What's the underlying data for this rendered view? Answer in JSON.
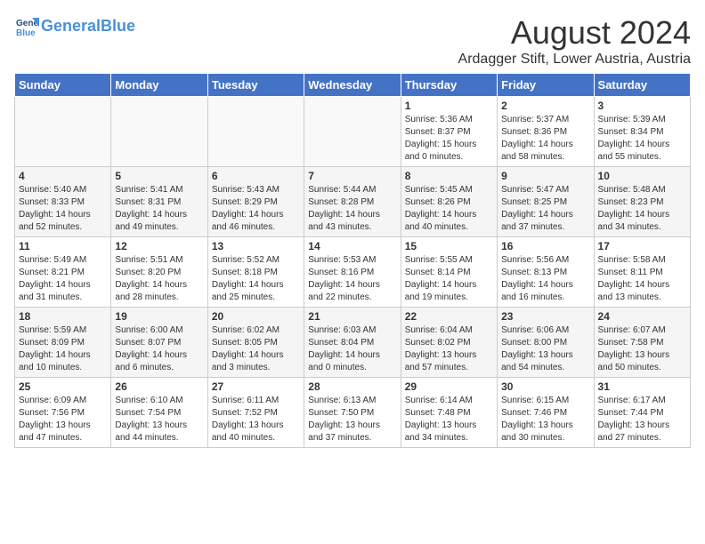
{
  "header": {
    "logo_line1": "General",
    "logo_line2": "Blue",
    "title": "August 2024",
    "subtitle": "Ardagger Stift, Lower Austria, Austria"
  },
  "weekdays": [
    "Sunday",
    "Monday",
    "Tuesday",
    "Wednesday",
    "Thursday",
    "Friday",
    "Saturday"
  ],
  "weeks": [
    [
      {
        "day": "",
        "info": ""
      },
      {
        "day": "",
        "info": ""
      },
      {
        "day": "",
        "info": ""
      },
      {
        "day": "",
        "info": ""
      },
      {
        "day": "1",
        "info": "Sunrise: 5:36 AM\nSunset: 8:37 PM\nDaylight: 15 hours\nand 0 minutes."
      },
      {
        "day": "2",
        "info": "Sunrise: 5:37 AM\nSunset: 8:36 PM\nDaylight: 14 hours\nand 58 minutes."
      },
      {
        "day": "3",
        "info": "Sunrise: 5:39 AM\nSunset: 8:34 PM\nDaylight: 14 hours\nand 55 minutes."
      }
    ],
    [
      {
        "day": "4",
        "info": "Sunrise: 5:40 AM\nSunset: 8:33 PM\nDaylight: 14 hours\nand 52 minutes."
      },
      {
        "day": "5",
        "info": "Sunrise: 5:41 AM\nSunset: 8:31 PM\nDaylight: 14 hours\nand 49 minutes."
      },
      {
        "day": "6",
        "info": "Sunrise: 5:43 AM\nSunset: 8:29 PM\nDaylight: 14 hours\nand 46 minutes."
      },
      {
        "day": "7",
        "info": "Sunrise: 5:44 AM\nSunset: 8:28 PM\nDaylight: 14 hours\nand 43 minutes."
      },
      {
        "day": "8",
        "info": "Sunrise: 5:45 AM\nSunset: 8:26 PM\nDaylight: 14 hours\nand 40 minutes."
      },
      {
        "day": "9",
        "info": "Sunrise: 5:47 AM\nSunset: 8:25 PM\nDaylight: 14 hours\nand 37 minutes."
      },
      {
        "day": "10",
        "info": "Sunrise: 5:48 AM\nSunset: 8:23 PM\nDaylight: 14 hours\nand 34 minutes."
      }
    ],
    [
      {
        "day": "11",
        "info": "Sunrise: 5:49 AM\nSunset: 8:21 PM\nDaylight: 14 hours\nand 31 minutes."
      },
      {
        "day": "12",
        "info": "Sunrise: 5:51 AM\nSunset: 8:20 PM\nDaylight: 14 hours\nand 28 minutes."
      },
      {
        "day": "13",
        "info": "Sunrise: 5:52 AM\nSunset: 8:18 PM\nDaylight: 14 hours\nand 25 minutes."
      },
      {
        "day": "14",
        "info": "Sunrise: 5:53 AM\nSunset: 8:16 PM\nDaylight: 14 hours\nand 22 minutes."
      },
      {
        "day": "15",
        "info": "Sunrise: 5:55 AM\nSunset: 8:14 PM\nDaylight: 14 hours\nand 19 minutes."
      },
      {
        "day": "16",
        "info": "Sunrise: 5:56 AM\nSunset: 8:13 PM\nDaylight: 14 hours\nand 16 minutes."
      },
      {
        "day": "17",
        "info": "Sunrise: 5:58 AM\nSunset: 8:11 PM\nDaylight: 14 hours\nand 13 minutes."
      }
    ],
    [
      {
        "day": "18",
        "info": "Sunrise: 5:59 AM\nSunset: 8:09 PM\nDaylight: 14 hours\nand 10 minutes."
      },
      {
        "day": "19",
        "info": "Sunrise: 6:00 AM\nSunset: 8:07 PM\nDaylight: 14 hours\nand 6 minutes."
      },
      {
        "day": "20",
        "info": "Sunrise: 6:02 AM\nSunset: 8:05 PM\nDaylight: 14 hours\nand 3 minutes."
      },
      {
        "day": "21",
        "info": "Sunrise: 6:03 AM\nSunset: 8:04 PM\nDaylight: 14 hours\nand 0 minutes."
      },
      {
        "day": "22",
        "info": "Sunrise: 6:04 AM\nSunset: 8:02 PM\nDaylight: 13 hours\nand 57 minutes."
      },
      {
        "day": "23",
        "info": "Sunrise: 6:06 AM\nSunset: 8:00 PM\nDaylight: 13 hours\nand 54 minutes."
      },
      {
        "day": "24",
        "info": "Sunrise: 6:07 AM\nSunset: 7:58 PM\nDaylight: 13 hours\nand 50 minutes."
      }
    ],
    [
      {
        "day": "25",
        "info": "Sunrise: 6:09 AM\nSunset: 7:56 PM\nDaylight: 13 hours\nand 47 minutes."
      },
      {
        "day": "26",
        "info": "Sunrise: 6:10 AM\nSunset: 7:54 PM\nDaylight: 13 hours\nand 44 minutes."
      },
      {
        "day": "27",
        "info": "Sunrise: 6:11 AM\nSunset: 7:52 PM\nDaylight: 13 hours\nand 40 minutes."
      },
      {
        "day": "28",
        "info": "Sunrise: 6:13 AM\nSunset: 7:50 PM\nDaylight: 13 hours\nand 37 minutes."
      },
      {
        "day": "29",
        "info": "Sunrise: 6:14 AM\nSunset: 7:48 PM\nDaylight: 13 hours\nand 34 minutes."
      },
      {
        "day": "30",
        "info": "Sunrise: 6:15 AM\nSunset: 7:46 PM\nDaylight: 13 hours\nand 30 minutes."
      },
      {
        "day": "31",
        "info": "Sunrise: 6:17 AM\nSunset: 7:44 PM\nDaylight: 13 hours\nand 27 minutes."
      }
    ]
  ]
}
